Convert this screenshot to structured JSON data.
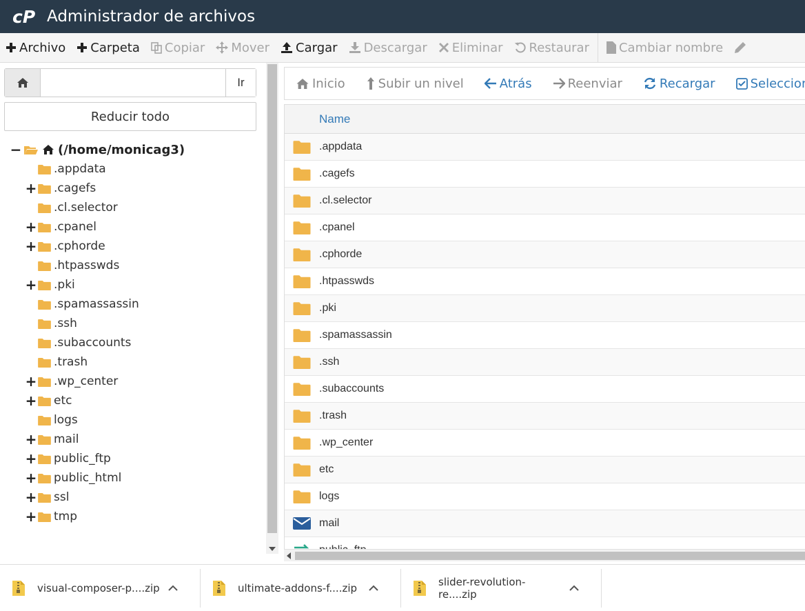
{
  "header": {
    "title": "Administrador de archivos"
  },
  "toolbar": {
    "items": [
      {
        "label": "Archivo",
        "icon": "plus-icon",
        "enabled": true
      },
      {
        "label": "Carpeta",
        "icon": "plus-icon",
        "enabled": true
      },
      {
        "label": "Copiar",
        "icon": "copy-icon",
        "enabled": false
      },
      {
        "label": "Mover",
        "icon": "move-icon",
        "enabled": false
      },
      {
        "label": "Cargar",
        "icon": "upload-icon",
        "enabled": true
      },
      {
        "label": "Descargar",
        "icon": "download-icon",
        "enabled": false
      },
      {
        "label": "Eliminar",
        "icon": "delete-icon",
        "enabled": false
      },
      {
        "label": "Restaurar",
        "icon": "restore-icon",
        "enabled": false
      },
      {
        "label": "Cambiar nombre",
        "icon": "file-icon",
        "enabled": false
      }
    ]
  },
  "left": {
    "path_value": "",
    "go_label": "Ir",
    "collapse_label": "Reducir todo",
    "root_label": "(/home/monicag3)",
    "tree": [
      {
        "label": ".appdata",
        "expandable": false
      },
      {
        "label": ".cagefs",
        "expandable": true
      },
      {
        "label": ".cl.selector",
        "expandable": false
      },
      {
        "label": ".cpanel",
        "expandable": true
      },
      {
        "label": ".cphorde",
        "expandable": true
      },
      {
        "label": ".htpasswds",
        "expandable": false
      },
      {
        "label": ".pki",
        "expandable": true
      },
      {
        "label": ".spamassassin",
        "expandable": false
      },
      {
        "label": ".ssh",
        "expandable": false
      },
      {
        "label": ".subaccounts",
        "expandable": false
      },
      {
        "label": ".trash",
        "expandable": false
      },
      {
        "label": ".wp_center",
        "expandable": true
      },
      {
        "label": "etc",
        "expandable": true
      },
      {
        "label": "logs",
        "expandable": false
      },
      {
        "label": "mail",
        "expandable": true
      },
      {
        "label": "public_ftp",
        "expandable": true
      },
      {
        "label": "public_html",
        "expandable": true
      },
      {
        "label": "ssl",
        "expandable": true
      },
      {
        "label": "tmp",
        "expandable": true
      }
    ]
  },
  "nav": {
    "items": [
      {
        "label": "Inicio",
        "icon": "home-icon",
        "style": "grey"
      },
      {
        "label": "Subir un nivel",
        "icon": "level-up-icon",
        "style": "grey"
      },
      {
        "label": "Atrás",
        "icon": "arrow-left-icon",
        "style": "blue"
      },
      {
        "label": "Reenviar",
        "icon": "arrow-right-icon",
        "style": "grey"
      },
      {
        "label": "Recargar",
        "icon": "reload-icon",
        "style": "blue"
      },
      {
        "label": "Seleccionar todo",
        "icon": "checkbox-icon",
        "style": "blue"
      }
    ]
  },
  "table": {
    "column_name": "Name",
    "rows": [
      {
        "name": ".appdata",
        "icon": "folder-icon"
      },
      {
        "name": ".cagefs",
        "icon": "folder-icon"
      },
      {
        "name": ".cl.selector",
        "icon": "folder-icon"
      },
      {
        "name": ".cpanel",
        "icon": "folder-icon"
      },
      {
        "name": ".cphorde",
        "icon": "folder-icon"
      },
      {
        "name": ".htpasswds",
        "icon": "folder-icon"
      },
      {
        "name": ".pki",
        "icon": "folder-icon"
      },
      {
        "name": ".spamassassin",
        "icon": "folder-icon"
      },
      {
        "name": ".ssh",
        "icon": "folder-icon"
      },
      {
        "name": ".subaccounts",
        "icon": "folder-icon"
      },
      {
        "name": ".trash",
        "icon": "folder-icon"
      },
      {
        "name": ".wp_center",
        "icon": "folder-icon"
      },
      {
        "name": "etc",
        "icon": "folder-icon"
      },
      {
        "name": "logs",
        "icon": "folder-icon"
      },
      {
        "name": "mail",
        "icon": "mail-icon"
      },
      {
        "name": "public_ftp",
        "icon": "ftp-icon"
      }
    ]
  },
  "downloads": [
    {
      "name": "visual-composer-p....zip"
    },
    {
      "name": "ultimate-addons-f....zip"
    },
    {
      "name": "slider-revolution-re....zip"
    }
  ],
  "colors": {
    "header_bg": "#293a4a",
    "folder": "#f0b54a",
    "link": "#337ab7",
    "mail": "#2b5e9c",
    "ftp": "#2aa88a"
  }
}
